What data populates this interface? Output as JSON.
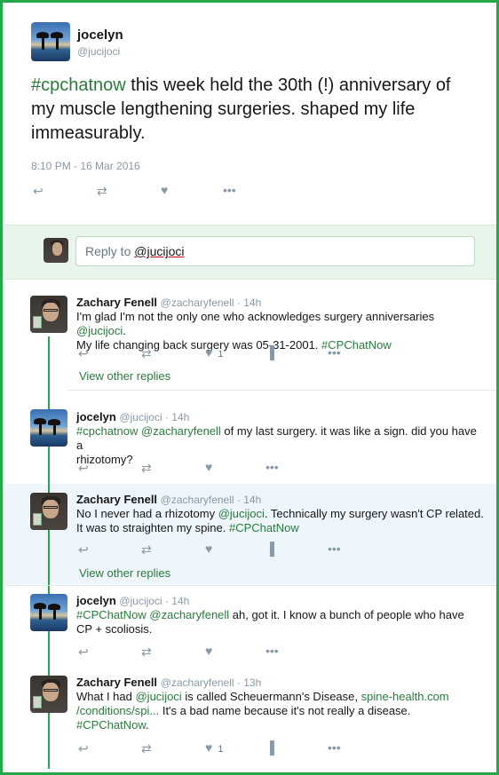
{
  "main_tweet": {
    "name": "jocelyn",
    "handle": "@jucijoci",
    "hashtag": "#cpchatnow",
    "text": " this week held the 30th (!) anniversary of my muscle lengthening surgeries. shaped my life immeasurably.",
    "timestamp": "8:10 PM - 16 Mar 2016"
  },
  "reply_box": {
    "prefix": "Reply to ",
    "mention": "@jucijoci"
  },
  "replies": [
    {
      "name": "Zachary Fenell",
      "handle": "@zacharyfenell",
      "time": "14h",
      "line1": "I'm glad I'm not the only one who acknowledges surgery anniversaries ",
      "line1_mention": "@jucijoci",
      "line1_end": ".",
      "line2": "My life changing back surgery was 05-31-2001. ",
      "line2_tag": "#CPChatNow",
      "likes": "1",
      "view_other": "View other replies"
    },
    {
      "name": "jocelyn",
      "handle": "@jucijoci",
      "time": "14h",
      "tag": "#cpchatnow",
      "mention": "@zacharyfenell",
      "text": " of my last surgery. it was like a sign. did you have a",
      "line2": "rhizotomy?"
    },
    {
      "name": "Zachary Fenell",
      "handle": "@zacharyfenell",
      "time": "14h",
      "line1": "No I never had a rhizotomy ",
      "mention": "@jucijoci",
      "line1_end": ". Technically my surgery wasn't CP related.",
      "line2": "It was to straighten my spine. ",
      "tag": "#CPChatNow",
      "view_other": "View other replies"
    },
    {
      "name": "jocelyn",
      "handle": "@jucijoci",
      "time": "14h",
      "tag": "#CPChatNow",
      "mention": "@zacharyfenell",
      "text": " ah, got it. I know a bunch of people who have",
      "line2": "CP + scoliosis."
    },
    {
      "name": "Zachary Fenell",
      "handle": "@zacharyfenell",
      "time": "13h",
      "line1": "What I had ",
      "mention": "@jucijoci",
      "line1_mid": " is called Scheuermann's Disease, ",
      "link1": "spine-health.com",
      "link2": "/conditions/spi...",
      "line2_end": " It's a bad name because it's not really a disease.",
      "tag": "#CPChatNow",
      "tag_end": ".",
      "likes": "1"
    }
  ],
  "sep": " · ",
  "colors": {
    "border": "#24a84a",
    "link": "#2b7a3d",
    "reply_bg": "#e8f5ea",
    "highlight": "#eef6fb"
  },
  "icons": [
    "reply-icon",
    "retweet-icon",
    "heart-icon",
    "more-icon",
    "analytics-icon"
  ]
}
